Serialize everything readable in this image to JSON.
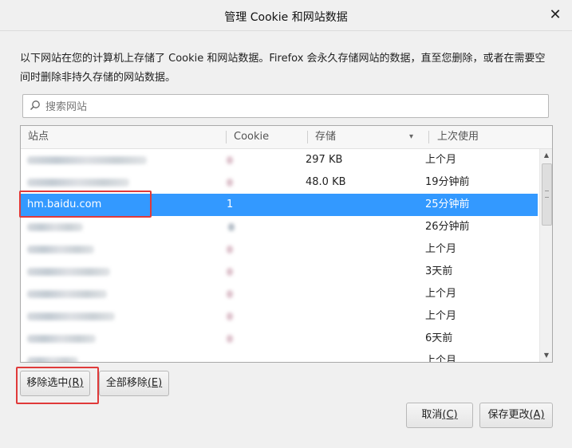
{
  "dialog": {
    "title": "管理 Cookie 和网站数据",
    "close_glyph": "✕",
    "description": "以下网站在您的计算机上存储了 Cookie 和网站数据。Firefox 会永久存储网站的数据，直至您删除，或者在需要空间时删除非持久存储的网站数据。"
  },
  "search": {
    "placeholder": "搜索网站",
    "value": ""
  },
  "table": {
    "columns": [
      "站点",
      "Cookie",
      "存储",
      "上次使用"
    ],
    "sort_indicator": "▾",
    "rows": [
      {
        "site": "",
        "cookie": "",
        "storage": "297 KB",
        "last_used": "上个月",
        "selected": false
      },
      {
        "site": "",
        "cookie": "",
        "storage": "48.0 KB",
        "last_used": "19分钟前",
        "selected": false
      },
      {
        "site": "hm.baidu.com",
        "cookie": "1",
        "storage": "",
        "last_used": "25分钟前",
        "selected": true
      },
      {
        "site": "",
        "cookie": "",
        "storage": "",
        "last_used": "26分钟前",
        "selected": false
      },
      {
        "site": "",
        "cookie": "",
        "storage": "",
        "last_used": "上个月",
        "selected": false
      },
      {
        "site": "",
        "cookie": "",
        "storage": "",
        "last_used": "3天前",
        "selected": false
      },
      {
        "site": "",
        "cookie": "",
        "storage": "",
        "last_used": "上个月",
        "selected": false
      },
      {
        "site": "",
        "cookie": "",
        "storage": "",
        "last_used": "上个月",
        "selected": false
      },
      {
        "site": "",
        "cookie": "",
        "storage": "",
        "last_used": "6天前",
        "selected": false
      },
      {
        "site": "",
        "cookie": "",
        "storage": "",
        "last_used": "上个月",
        "selected": false
      }
    ]
  },
  "buttons": {
    "remove_selected": {
      "label": "移除选中",
      "accesskey": "(R)"
    },
    "remove_all": {
      "label": "全部移除",
      "accesskey": "(E)"
    },
    "cancel": {
      "label": "取消",
      "accesskey": "(C)"
    },
    "save": {
      "label": "保存更改",
      "accesskey": "(A)"
    }
  },
  "colors": {
    "selection": "#3399ff",
    "highlight_box": "#e03a3a"
  }
}
